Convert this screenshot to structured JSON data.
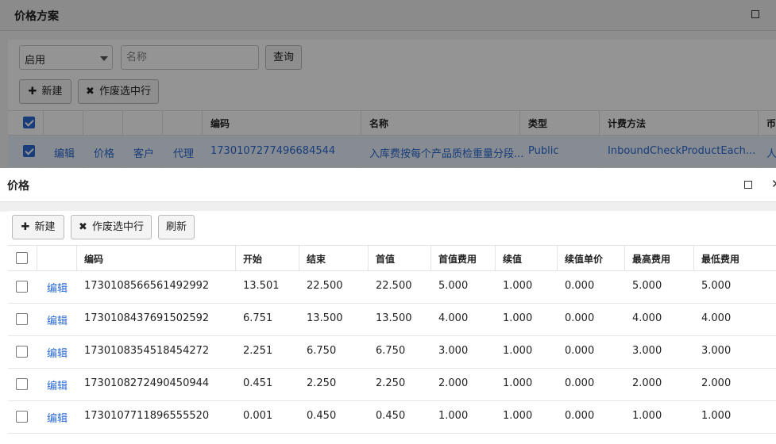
{
  "background_window": {
    "title": "价格方案",
    "filter": {
      "status_value": "启用",
      "name_placeholder": "名称",
      "query_label": "查询"
    },
    "toolbar": {
      "new_label": "新建",
      "void_label": "作废选中行"
    },
    "columns": [
      "编码",
      "名称",
      "类型",
      "计费方法",
      "币"
    ],
    "row": {
      "actions": [
        "编辑",
        "价格",
        "客户",
        "代理"
      ],
      "code": "1730107277496684544",
      "name": "入库费按每个产品质检重量分段...",
      "type": "Public",
      "method": "InboundCheckProductEach...",
      "currency": "人"
    }
  },
  "dialog": {
    "title": "价格",
    "toolbar": {
      "new_label": "新建",
      "void_label": "作废选中行",
      "refresh_label": "刷新"
    },
    "columns": [
      "编码",
      "开始",
      "结束",
      "首值",
      "首值费用",
      "续值",
      "续值单价",
      "最高费用",
      "最低费用"
    ],
    "edit_label": "编辑",
    "rows": [
      [
        "1730108566561492992",
        "13.501",
        "22.500",
        "22.500",
        "5.000",
        "1.000",
        "0.000",
        "5.000",
        "5.000"
      ],
      [
        "1730108437691502592",
        "6.751",
        "13.500",
        "13.500",
        "4.000",
        "1.000",
        "0.000",
        "4.000",
        "4.000"
      ],
      [
        "1730108354518454272",
        "2.251",
        "6.750",
        "6.750",
        "3.000",
        "1.000",
        "0.000",
        "3.000",
        "3.000"
      ],
      [
        "1730108272490450944",
        "0.451",
        "2.250",
        "2.250",
        "2.000",
        "1.000",
        "0.000",
        "2.000",
        "2.000"
      ],
      [
        "1730107711896555520",
        "0.001",
        "0.450",
        "0.450",
        "1.000",
        "1.000",
        "0.000",
        "1.000",
        "1.000"
      ]
    ]
  },
  "colors": {
    "accent": "#2a6ad3",
    "overlay": "rgba(0,0,0,0.42)"
  }
}
